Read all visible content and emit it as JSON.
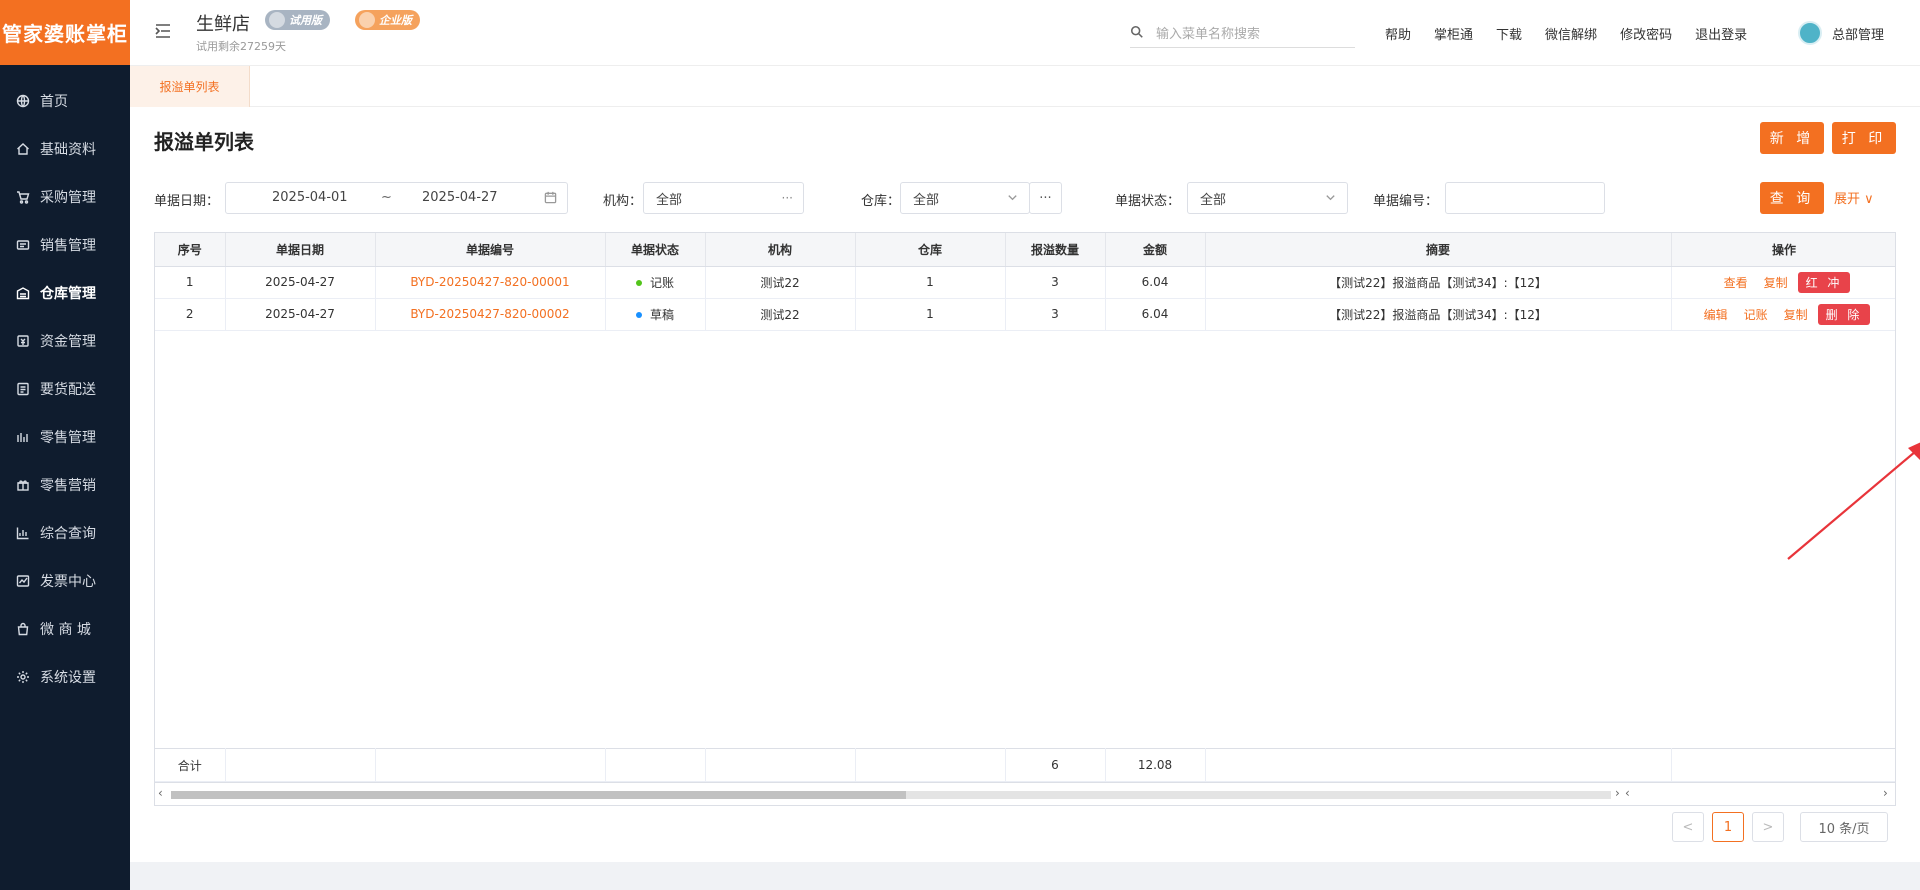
{
  "logo": {
    "text": "管家婆账掌柜"
  },
  "sidebar": {
    "items": [
      {
        "label": "首页",
        "icon": "globe-icon"
      },
      {
        "label": "基础资料",
        "icon": "home-icon"
      },
      {
        "label": "采购管理",
        "icon": "cart-icon"
      },
      {
        "label": "销售管理",
        "icon": "sales-icon"
      },
      {
        "label": "仓库管理",
        "icon": "warehouse-icon"
      },
      {
        "label": "资金管理",
        "icon": "finance-icon"
      },
      {
        "label": "要货配送",
        "icon": "delivery-icon"
      },
      {
        "label": "零售管理",
        "icon": "retail-icon"
      },
      {
        "label": "零售营销",
        "icon": "gift-icon"
      },
      {
        "label": "综合查询",
        "icon": "chart-icon"
      },
      {
        "label": "发票中心",
        "icon": "invoice-icon"
      },
      {
        "label": "微 商 城",
        "icon": "bag-icon"
      },
      {
        "label": "系统设置",
        "icon": "gear-icon"
      }
    ],
    "active_index": 4
  },
  "header": {
    "store_name": "生鲜店",
    "badge_trial": "试用版",
    "badge_pro": "企业版",
    "trial_days": "试用剩余27259天",
    "search_placeholder": "输入菜单名称搜索",
    "links": [
      "帮助",
      "掌柜通",
      "下载",
      "微信解绑",
      "修改密码",
      "退出登录"
    ],
    "user_name": "总部管理"
  },
  "tabs": [
    {
      "label": "报溢单列表"
    }
  ],
  "page": {
    "title": "报溢单列表",
    "add_label": "新 增",
    "print_label": "打 印",
    "query_label": "查 询",
    "expand_label": "展开"
  },
  "filters": {
    "date_label": "单据日期：",
    "date_start": "2025-04-01",
    "date_sep": "~",
    "date_end": "2025-04-27",
    "org_label": "机构：",
    "org_value": "全部",
    "warehouse_label": "仓库：",
    "warehouse_value": "全部",
    "status_label": "单据状态：",
    "status_value": "全部",
    "billno_label": "单据编号：",
    "billno_value": ""
  },
  "table": {
    "headers": [
      "序号",
      "单据日期",
      "单据编号",
      "单据状态",
      "机构",
      "仓库",
      "报溢数量",
      "金额",
      "摘要",
      "操作"
    ],
    "rows": [
      {
        "no": "1",
        "date": "2025-04-27",
        "bill_no": "BYD-20250427-820-00001",
        "status": "记账",
        "status_color": "#52c41a",
        "org": "测试22",
        "warehouse": "1",
        "qty": "3",
        "amount": "6.04",
        "summary": "【测试22】报溢商品【测试34】:【12】",
        "ops": [
          "查看",
          "复制"
        ],
        "red_op": "红 冲"
      },
      {
        "no": "2",
        "date": "2025-04-27",
        "bill_no": "BYD-20250427-820-00002",
        "status": "草稿",
        "status_color": "#1890ff",
        "org": "测试22",
        "warehouse": "1",
        "qty": "3",
        "amount": "6.04",
        "summary": "【测试22】报溢商品【测试34】:【12】",
        "ops": [
          "编辑",
          "记账",
          "复制"
        ],
        "red_op": "删 除"
      }
    ],
    "summary": {
      "label": "合计",
      "qty": "6",
      "amount": "12.08"
    }
  },
  "pagination": {
    "current": "1",
    "page_size": "10 条/页"
  },
  "colors": {
    "accent": "#f37021",
    "sidebar_bg": "#0f1c2e",
    "danger": "#e8434a"
  }
}
